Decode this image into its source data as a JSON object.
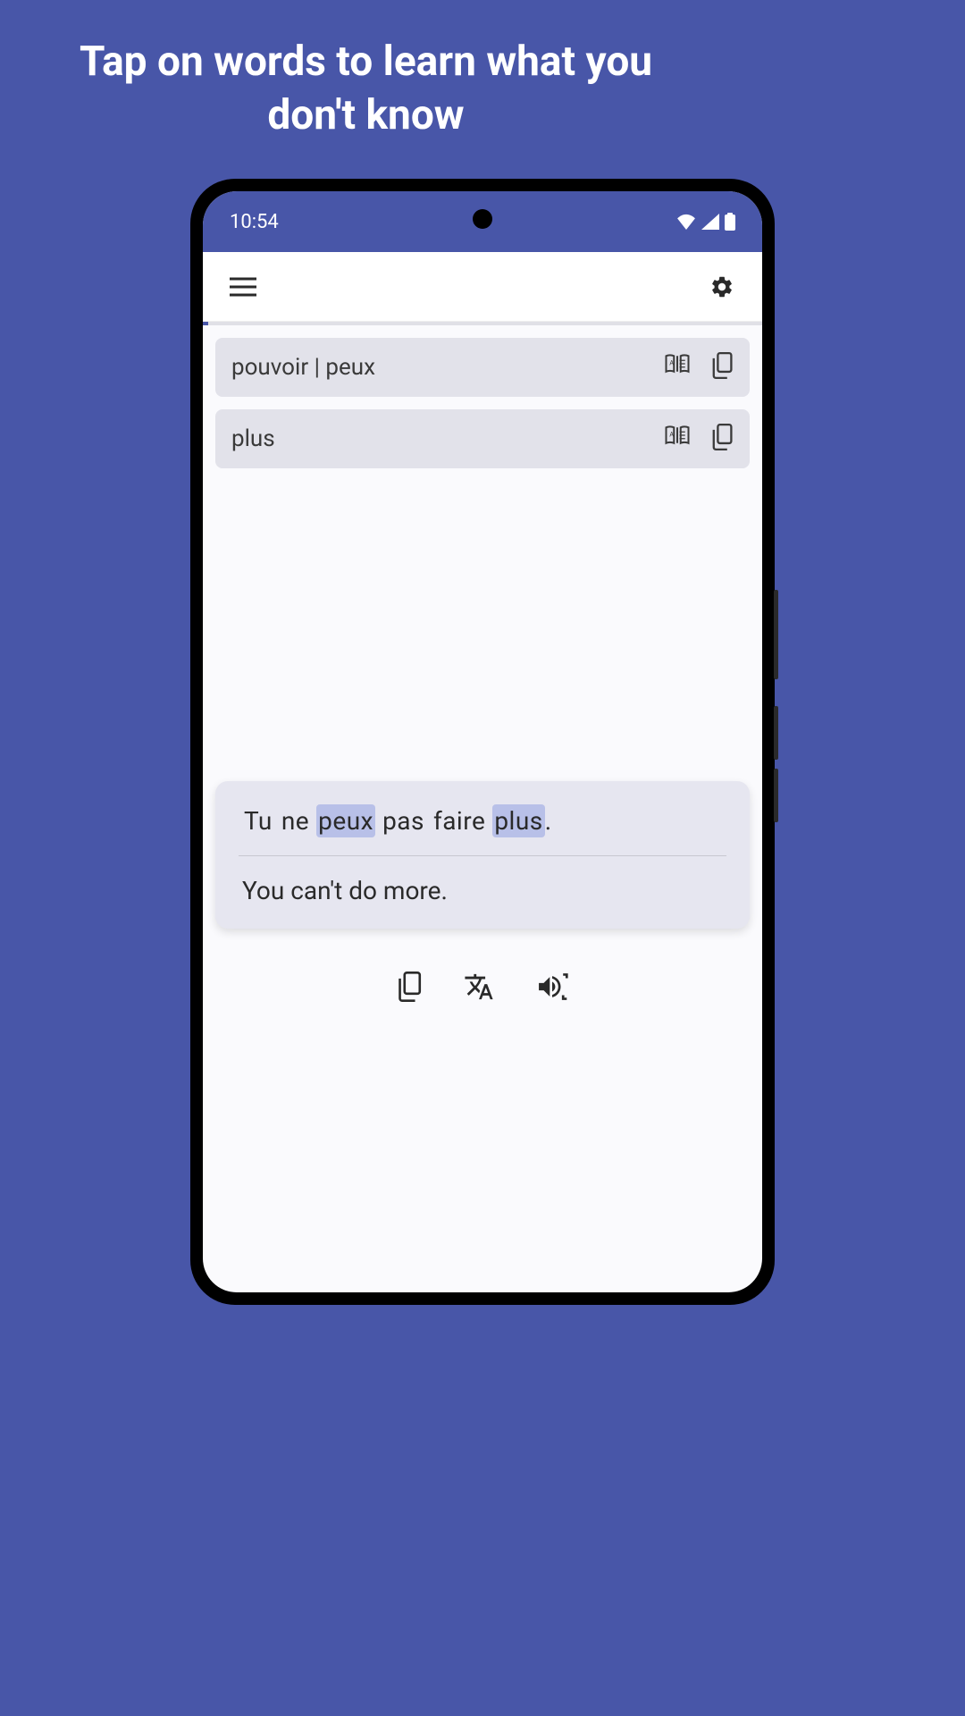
{
  "promo": {
    "headline": "Tap on words to learn what you don't know"
  },
  "status": {
    "time": "10:54"
  },
  "word_cards": [
    {
      "text": "pouvoir | peux"
    },
    {
      "text": "plus"
    }
  ],
  "sentence": {
    "words": [
      {
        "t": "Tu",
        "hl": false
      },
      {
        "t": "ne",
        "hl": false
      },
      {
        "t": "peux",
        "hl": true
      },
      {
        "t": "pas",
        "hl": false
      },
      {
        "t": "faire",
        "hl": false
      },
      {
        "t": "plus",
        "hl": true
      }
    ],
    "punct": ".",
    "translation": "You can't do more."
  }
}
